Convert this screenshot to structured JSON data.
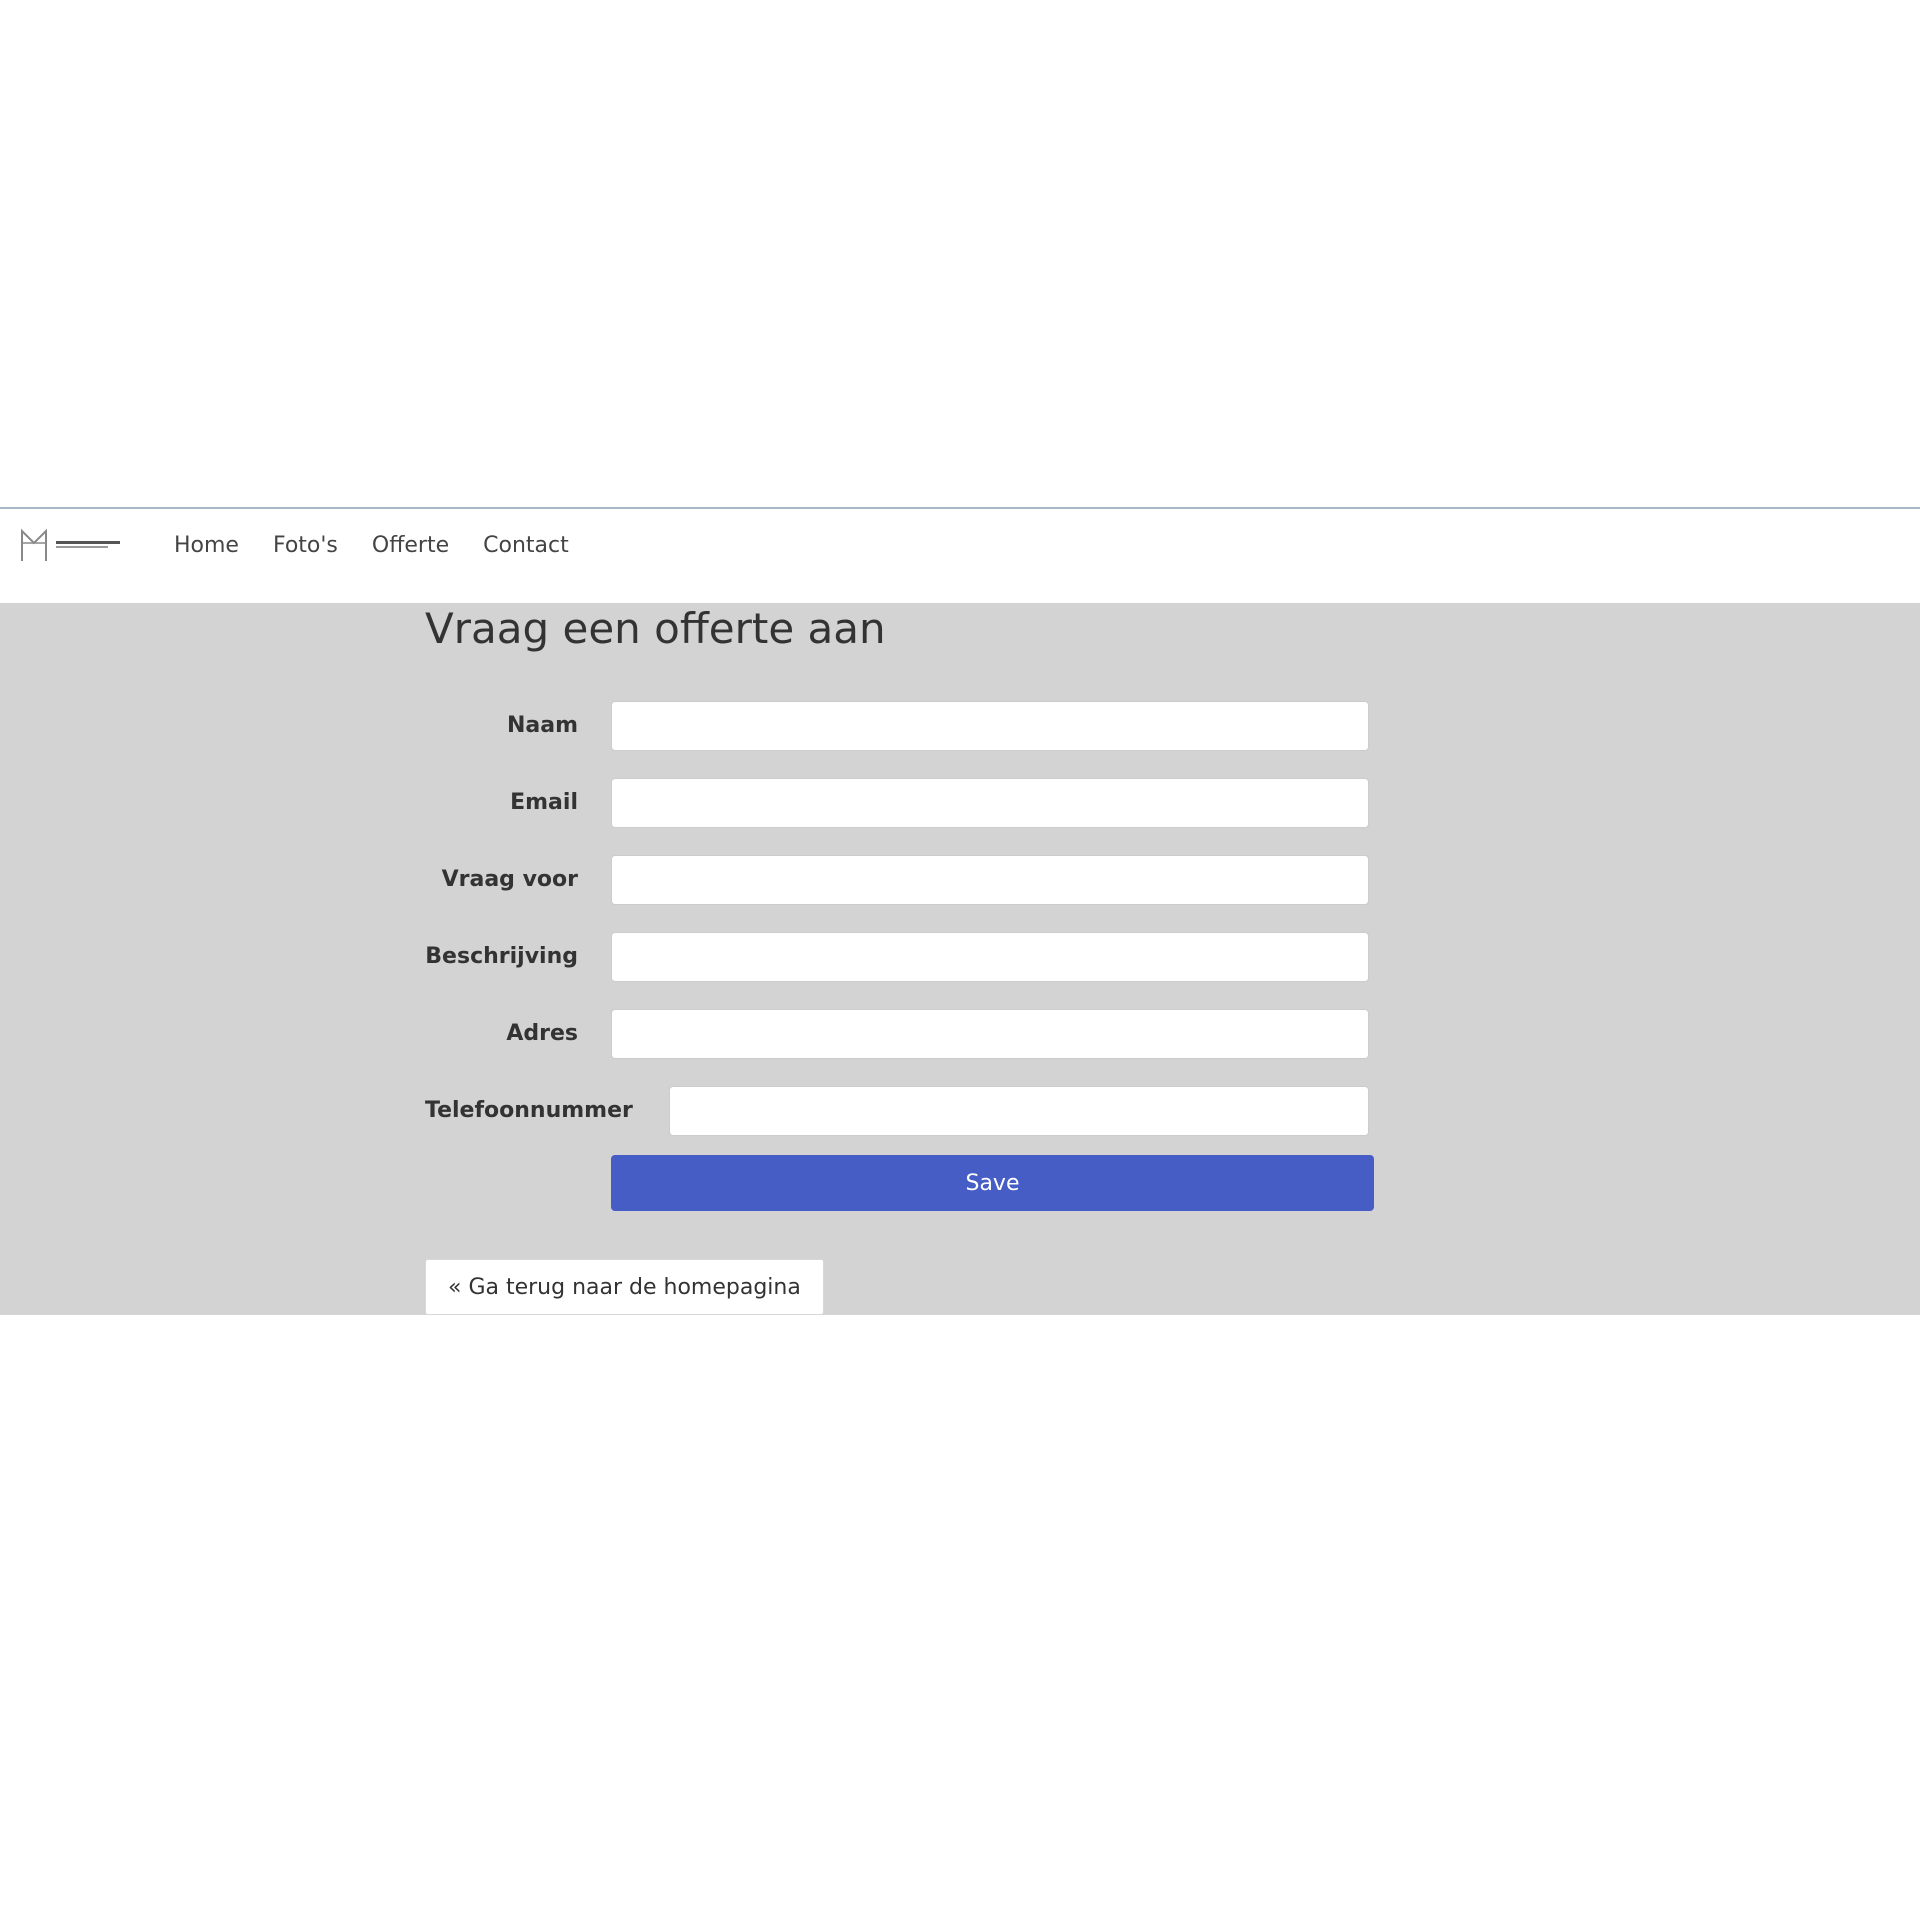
{
  "navbar": {
    "logo": "brand-logo",
    "links": [
      "Home",
      "Foto's",
      "Offerte",
      "Contact"
    ]
  },
  "page": {
    "title": "Vraag een offerte aan"
  },
  "form": {
    "fields": [
      {
        "label": "Naam",
        "value": "",
        "placeholder": ""
      },
      {
        "label": "Email",
        "value": "",
        "placeholder": ""
      },
      {
        "label": "Vraag voor",
        "value": "",
        "placeholder": ""
      },
      {
        "label": "Beschrijving",
        "value": "",
        "placeholder": ""
      },
      {
        "label": "Adres",
        "value": "",
        "placeholder": ""
      },
      {
        "label": "Telefoonnummer",
        "value": "",
        "placeholder": ""
      }
    ],
    "save_label": "Save"
  },
  "back_link": "« Ga terug naar de homepagina",
  "colors": {
    "primary_button": "#465dc6",
    "content_background": "#d3d3d3",
    "navbar_border": "#a9b8c6"
  }
}
